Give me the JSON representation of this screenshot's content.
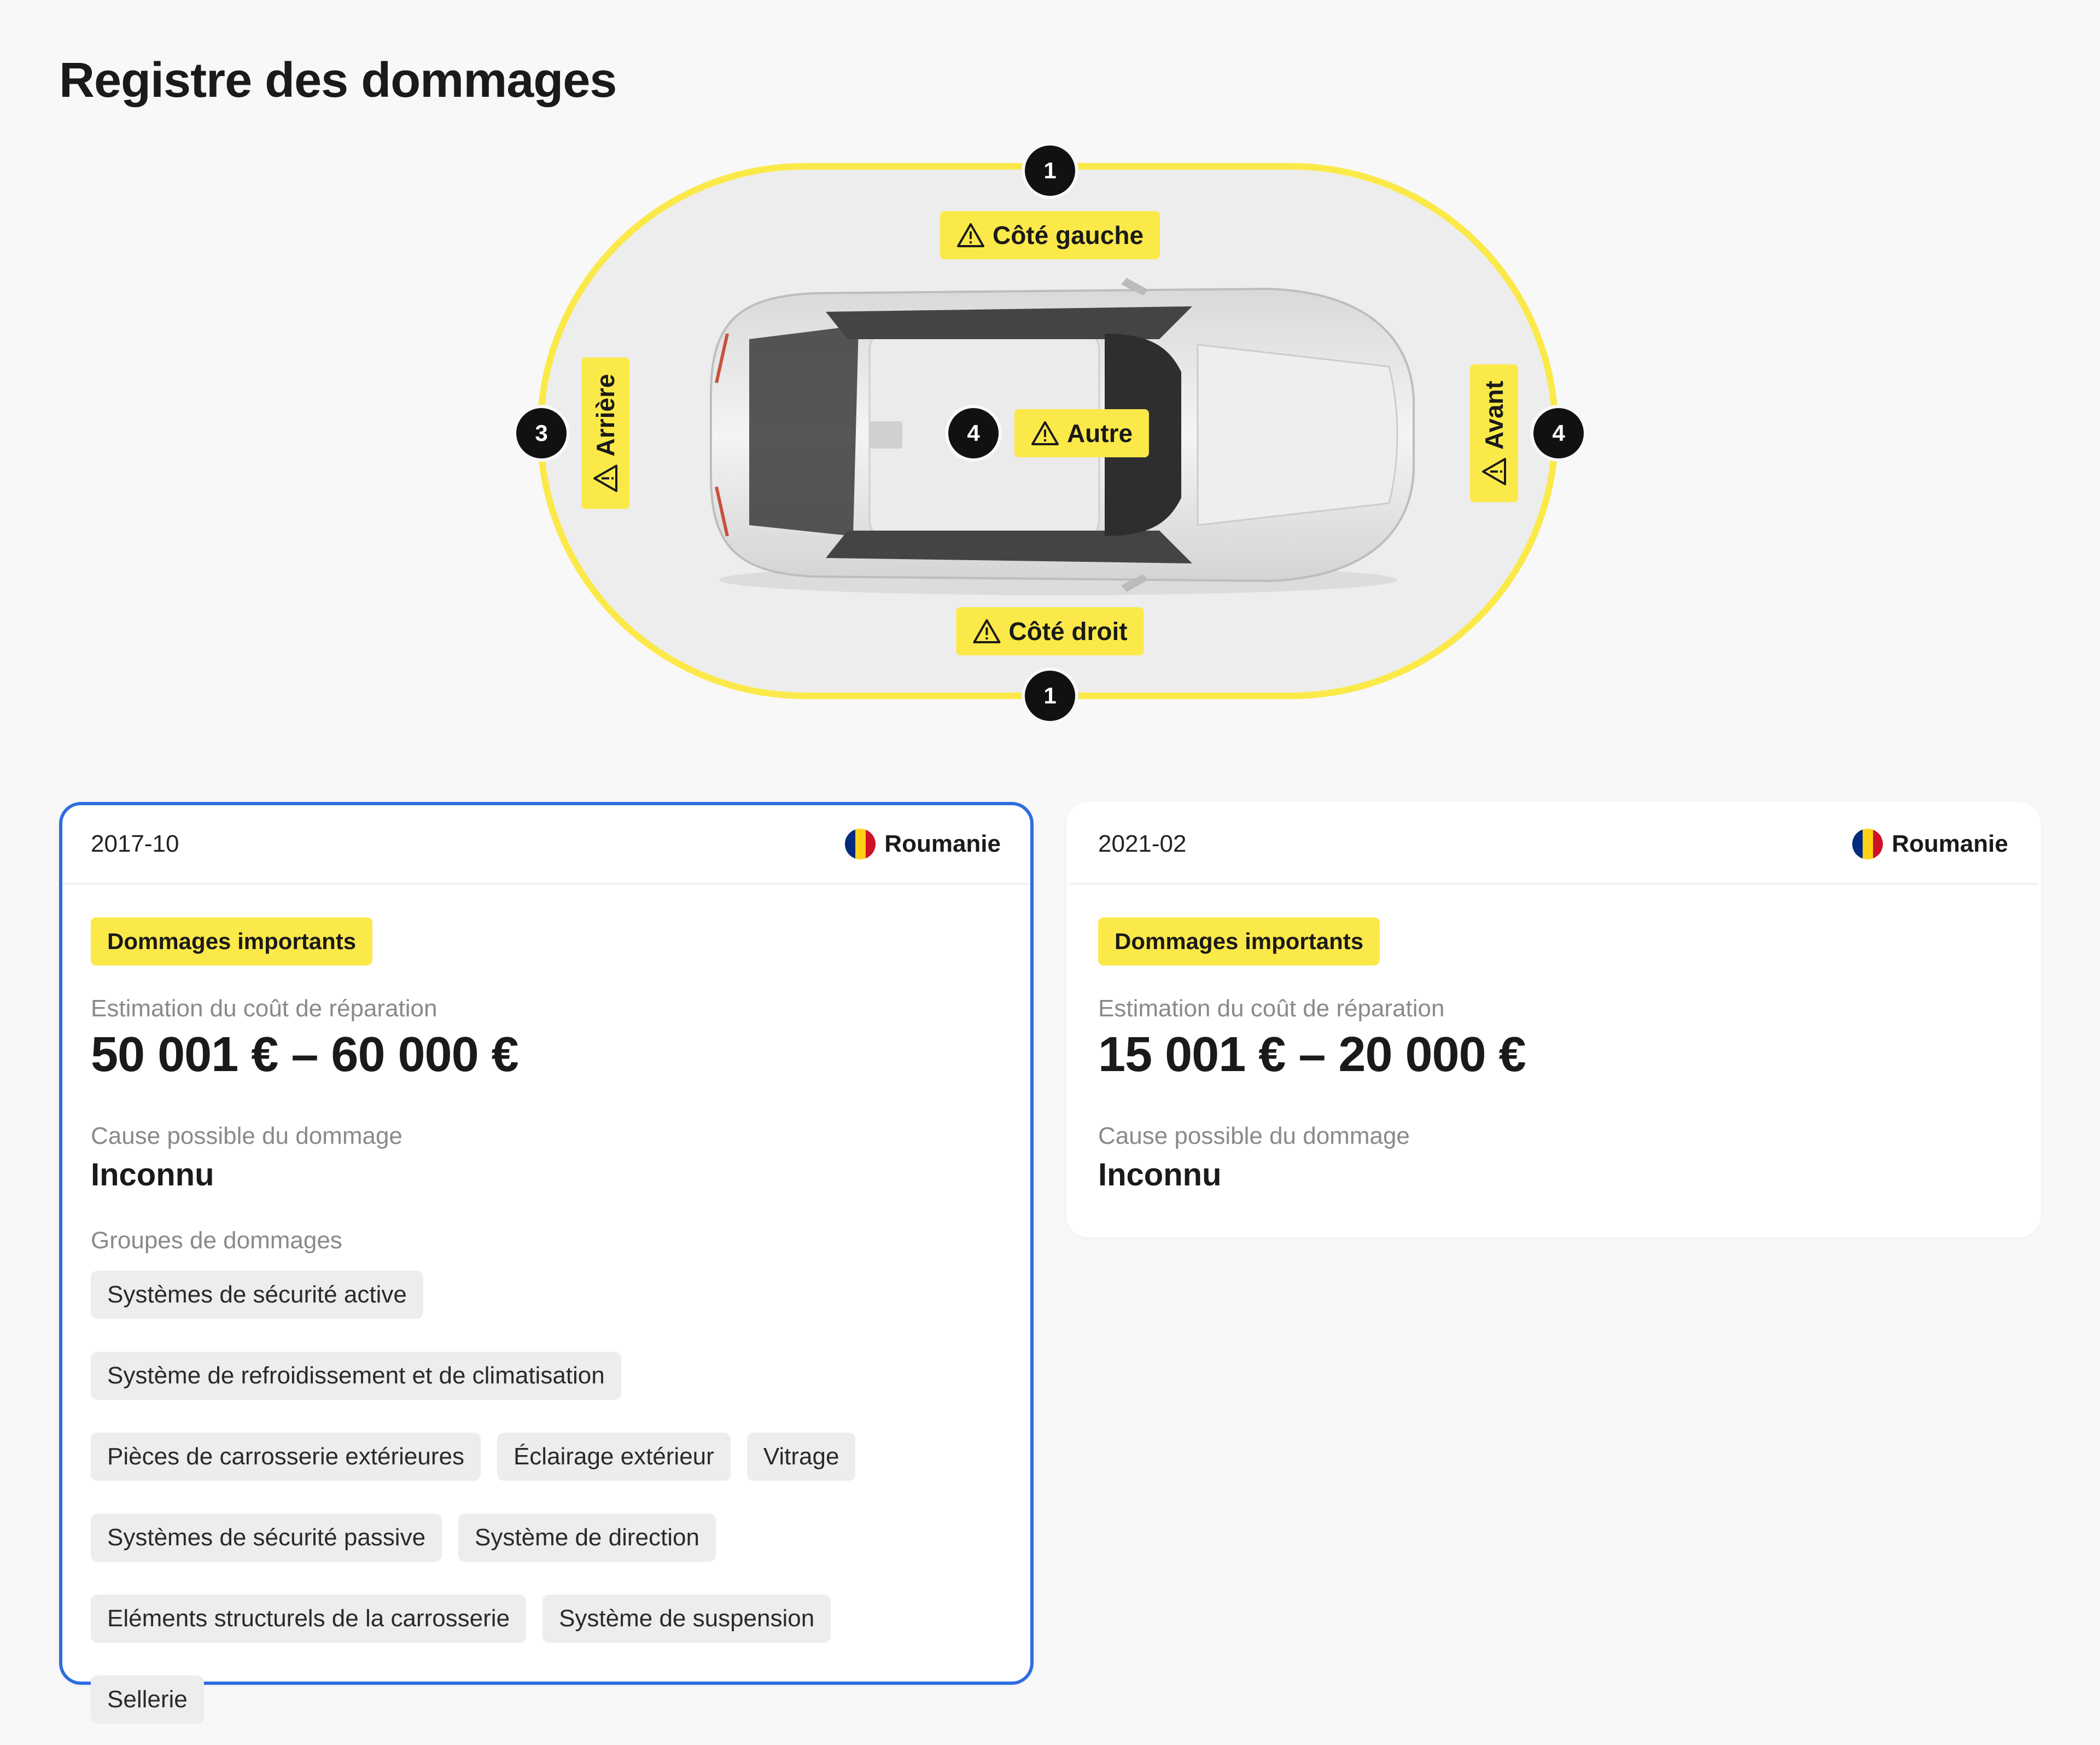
{
  "page": {
    "title": "Registre des dommages"
  },
  "diagram": {
    "zones": {
      "left_side": {
        "label": "Côté gauche",
        "count": "1"
      },
      "right_side": {
        "label": "Côté droit",
        "count": "1"
      },
      "rear": {
        "label": "Arrière",
        "count": "3"
      },
      "front": {
        "label": "Avant",
        "count": "4"
      },
      "other": {
        "label": "Autre",
        "count": "4"
      }
    },
    "colors": {
      "highlight": "#fbe94a",
      "counter": "#111111"
    },
    "icons": {
      "zone": "warning-triangle-icon",
      "vehicle": "car-top-view-image"
    }
  },
  "records": [
    {
      "date": "2017-10",
      "country": "Roumanie",
      "flag_icon": "romania-flag-icon",
      "severity": "Dommages importants",
      "cost_label": "Estimation du coût de réparation",
      "cost": "50 001 € – 60 000 €",
      "cause_label": "Cause possible du dommage",
      "cause": "Inconnu",
      "groups_label": "Groupes de dommages",
      "groups": [
        "Systèmes de sécurité active",
        "Système de refroidissement et de climatisation",
        "Pièces de carrosserie extérieures",
        "Éclairage extérieur",
        "Vitrage",
        "Systèmes de sécurité passive",
        "Système de direction",
        "Eléments structurels de la carrosserie",
        "Système de suspension",
        "Sellerie"
      ]
    },
    {
      "date": "2021-02",
      "country": "Roumanie",
      "flag_icon": "romania-flag-icon",
      "severity": "Dommages importants",
      "cost_label": "Estimation du coût de réparation",
      "cost": "15 001 € – 20 000 €",
      "cause_label": "Cause possible du dommage",
      "cause": "Inconnu"
    }
  ],
  "colors": {
    "accent_selected": "#2f6ddf",
    "severity_badge": "#fbe94a",
    "flag": [
      "#002B7F",
      "#FCD116",
      "#CE1126"
    ]
  }
}
